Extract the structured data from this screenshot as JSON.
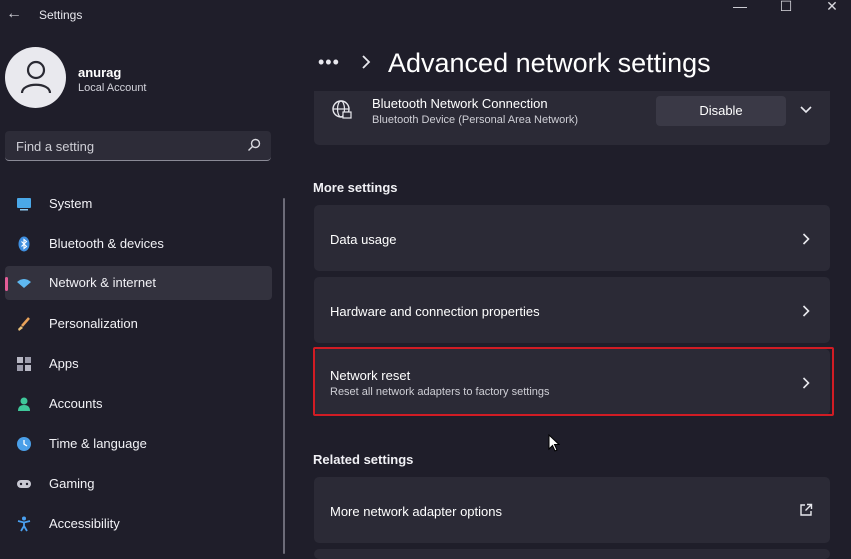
{
  "window": {
    "title": "Settings",
    "back_glyph": "←",
    "min_glyph": "—",
    "max_glyph": "☐",
    "close_glyph": "✕"
  },
  "account": {
    "name": "anurag",
    "type": "Local Account"
  },
  "search": {
    "placeholder": "Find a setting"
  },
  "nav": [
    {
      "label": "System",
      "icon": "system-icon",
      "color": "#4aa8e8"
    },
    {
      "label": "Bluetooth & devices",
      "icon": "bluetooth-icon",
      "color": "#3f8fe0"
    },
    {
      "label": "Network & internet",
      "icon": "wifi-icon",
      "color": "#5fb8f0",
      "selected": true
    },
    {
      "label": "Personalization",
      "icon": "brush-icon",
      "color": "#e8a25a"
    },
    {
      "label": "Apps",
      "icon": "apps-icon",
      "color": "#b8b8c4"
    },
    {
      "label": "Accounts",
      "icon": "person-icon",
      "color": "#3fc79a"
    },
    {
      "label": "Time & language",
      "icon": "globe-clock-icon",
      "color": "#4a9fe8"
    },
    {
      "label": "Gaming",
      "icon": "gamepad-icon",
      "color": "#c8c8d2"
    },
    {
      "label": "Accessibility",
      "icon": "accessibility-icon",
      "color": "#4aa0f0"
    }
  ],
  "header": {
    "overflow": "•••",
    "title": "Advanced network settings"
  },
  "adapter": {
    "name": "Bluetooth Network Connection",
    "description": "Bluetooth Device (Personal Area Network)",
    "button": "Disable"
  },
  "more_settings": {
    "heading": "More settings",
    "items": [
      {
        "title": "Data usage"
      },
      {
        "title": "Hardware and connection properties"
      },
      {
        "title": "Network reset",
        "subtitle": "Reset all network adapters to factory settings"
      }
    ]
  },
  "related_settings": {
    "heading": "Related settings",
    "items": [
      {
        "title": "More network adapter options"
      }
    ]
  },
  "colors": {
    "accent": "#e25c97",
    "highlight": "#d11c24",
    "background": "#1f1e2a",
    "card": "#2b2a36"
  }
}
